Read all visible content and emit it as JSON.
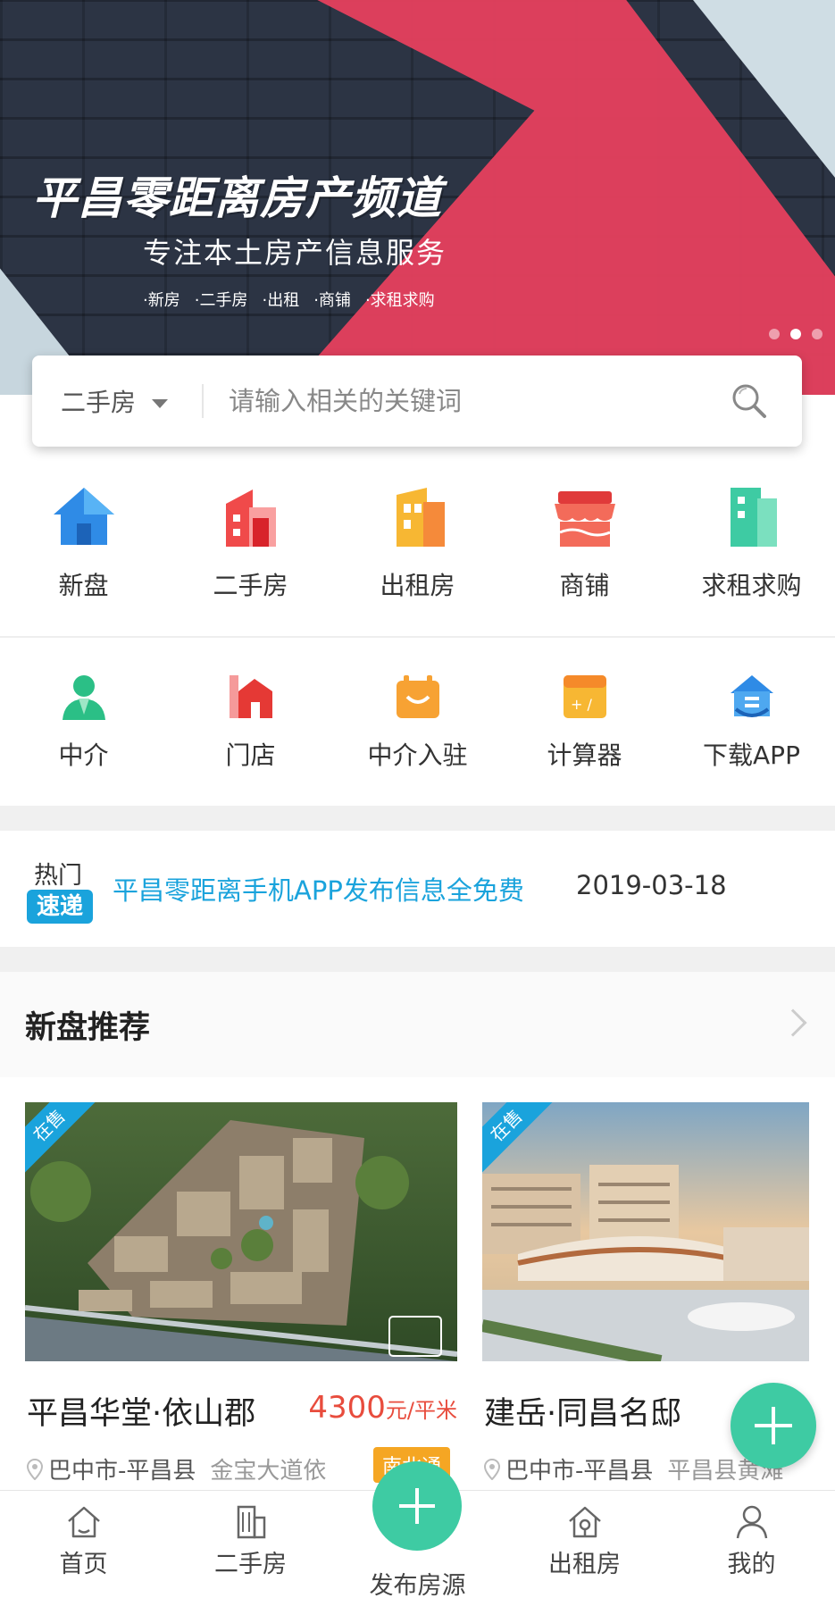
{
  "banner": {
    "title": "平昌零距离房产频道",
    "subtitle": "专注本土房产信息服务",
    "tags": [
      "·新房",
      "·二手房",
      "·出租",
      "·商铺",
      "·求租求购"
    ]
  },
  "search": {
    "type_label": "二手房",
    "placeholder": "请输入相关的关键词"
  },
  "grid1": [
    {
      "label": "新盘",
      "icon": "house-icon"
    },
    {
      "label": "二手房",
      "icon": "building-icon"
    },
    {
      "label": "出租房",
      "icon": "apartment-icon"
    },
    {
      "label": "商铺",
      "icon": "shop-icon"
    },
    {
      "label": "求租求购",
      "icon": "tower-icon"
    }
  ],
  "grid2": [
    {
      "label": "中介",
      "icon": "agent-icon"
    },
    {
      "label": "门店",
      "icon": "store-icon"
    },
    {
      "label": "中介入驻",
      "icon": "calendar-icon"
    },
    {
      "label": "计算器",
      "icon": "calculator-icon"
    },
    {
      "label": "下载APP",
      "icon": "download-icon"
    }
  ],
  "news": {
    "hot_label": "热门",
    "express_label": "速递",
    "text": "平昌零距离手机APP发布信息全免费",
    "date": "2019-03-18"
  },
  "section": {
    "title": "新盘推荐"
  },
  "listings": [
    {
      "ribbon": "在售",
      "name": "平昌华堂·依山郡",
      "price": "4300",
      "unit": "元/平米",
      "location": "巴中市-平昌县",
      "address": "金宝大道依",
      "tag": "南北通"
    },
    {
      "ribbon": "在售",
      "name": "建岳·同昌名邸",
      "location": "巴中市-平昌县",
      "address": "平昌县黄滩"
    }
  ],
  "tabbar": [
    {
      "label": "首页"
    },
    {
      "label": "二手房"
    },
    {
      "label": "发布房源"
    },
    {
      "label": "出租房"
    },
    {
      "label": "我的"
    }
  ],
  "colors": {
    "accent_blue": "#1aa3dc",
    "accent_green": "#3ecba3",
    "price_red": "#e84c3d",
    "banner_red": "#e6405e"
  }
}
